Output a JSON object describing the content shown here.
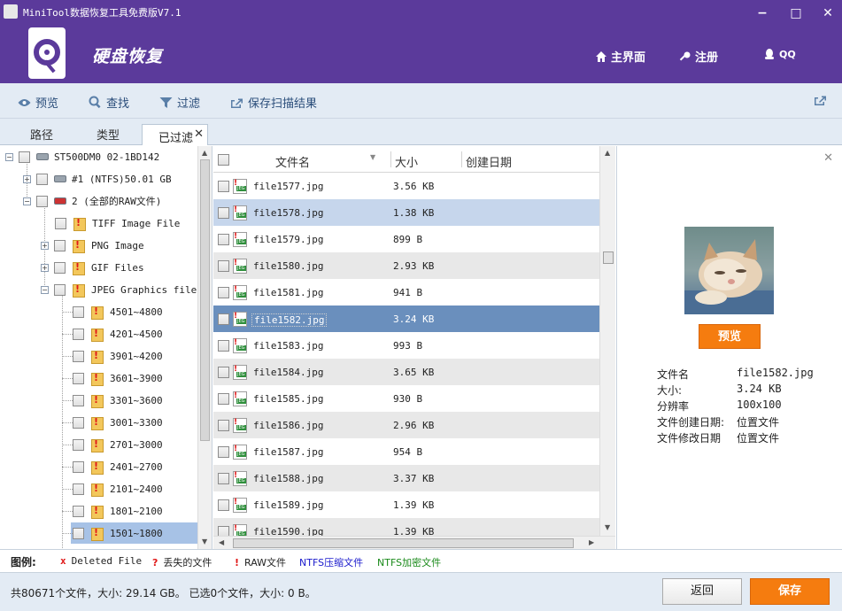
{
  "window": {
    "title": "MiniTool数据恢复工具免费版V7.1",
    "minimize_glyph": "−",
    "maximize_glyph": "□",
    "close_glyph": "✕"
  },
  "header": {
    "module_title": "硬盘恢复",
    "home_label": "主界面",
    "register_label": "注册",
    "qq_label": "QQ"
  },
  "toolbar": {
    "preview_label": "预览",
    "find_label": "查找",
    "filter_label": "过滤",
    "save_scan_label": "保存扫描结果"
  },
  "tabs": {
    "path": "路径",
    "type": "类型",
    "filtered": "已过滤",
    "close_glyph": "✕"
  },
  "tree": {
    "disk": "ST500DM0 02-1BD142",
    "partition1": "#1 (NTFS)50.01 GB",
    "partition2": "2 (全部的RAW文件)",
    "tiff": "TIFF Image File",
    "png": "PNG Image",
    "gif": "GIF Files",
    "jpeg": "JPEG Graphics file",
    "ranges": [
      "4501~4800",
      "4201~4500",
      "3901~4200",
      "3601~3900",
      "3301~3600",
      "3001~3300",
      "2701~3000",
      "2401~2700",
      "2101~2400",
      "1801~2100",
      "1501~1800"
    ]
  },
  "filelist": {
    "col_name": "文件名",
    "col_size": "大小",
    "col_created": "创建日期",
    "rows": [
      {
        "name": "file1577.jpg",
        "size": "3.56 KB"
      },
      {
        "name": "file1578.jpg",
        "size": "1.38 KB"
      },
      {
        "name": "file1579.jpg",
        "size": "899 B"
      },
      {
        "name": "file1580.jpg",
        "size": "2.93 KB"
      },
      {
        "name": "file1581.jpg",
        "size": "941 B"
      },
      {
        "name": "file1582.jpg",
        "size": "3.24 KB"
      },
      {
        "name": "file1583.jpg",
        "size": "993 B"
      },
      {
        "name": "file1584.jpg",
        "size": "3.65 KB"
      },
      {
        "name": "file1585.jpg",
        "size": "930 B"
      },
      {
        "name": "file1586.jpg",
        "size": "2.96 KB"
      },
      {
        "name": "file1587.jpg",
        "size": "954 B"
      },
      {
        "name": "file1588.jpg",
        "size": "3.37 KB"
      },
      {
        "name": "file1589.jpg",
        "size": "1.39 KB"
      },
      {
        "name": "file1590.jpg",
        "size": "1.39 KB"
      }
    ]
  },
  "preview": {
    "close_glyph": "✕",
    "button_label": "预览",
    "info": [
      {
        "label": "文件名",
        "value": "file1582.jpg"
      },
      {
        "label": "大小:",
        "value": "3.24 KB"
      },
      {
        "label": "分辨率",
        "value": "100x100"
      },
      {
        "label": "文件创建日期:",
        "value": "位置文件"
      },
      {
        "label": "文件修改日期",
        "value": "位置文件"
      }
    ]
  },
  "legend": {
    "title": "图例:",
    "deleted_mark": "x",
    "deleted": "Deleted File",
    "lost_mark": "?",
    "lost": "丢失的文件",
    "raw_mark": "!",
    "raw": "RAW文件",
    "ntfs_compressed": "NTFS压缩文件",
    "ntfs_encrypted": "NTFS加密文件",
    "ntfs_compressed_color": "#1a1acc",
    "ntfs_encrypted_color": "#1a8a1a"
  },
  "footer": {
    "summary": "共80671个文件，大小: 29.14 GB。 已选0个文件，大小: 0 B。",
    "back_label": "返回",
    "save_label": "保存"
  },
  "colors": {
    "header_bg": "#5b3a9b",
    "accent_orange": "#f57c0f",
    "selection": "#6a8fbd"
  }
}
